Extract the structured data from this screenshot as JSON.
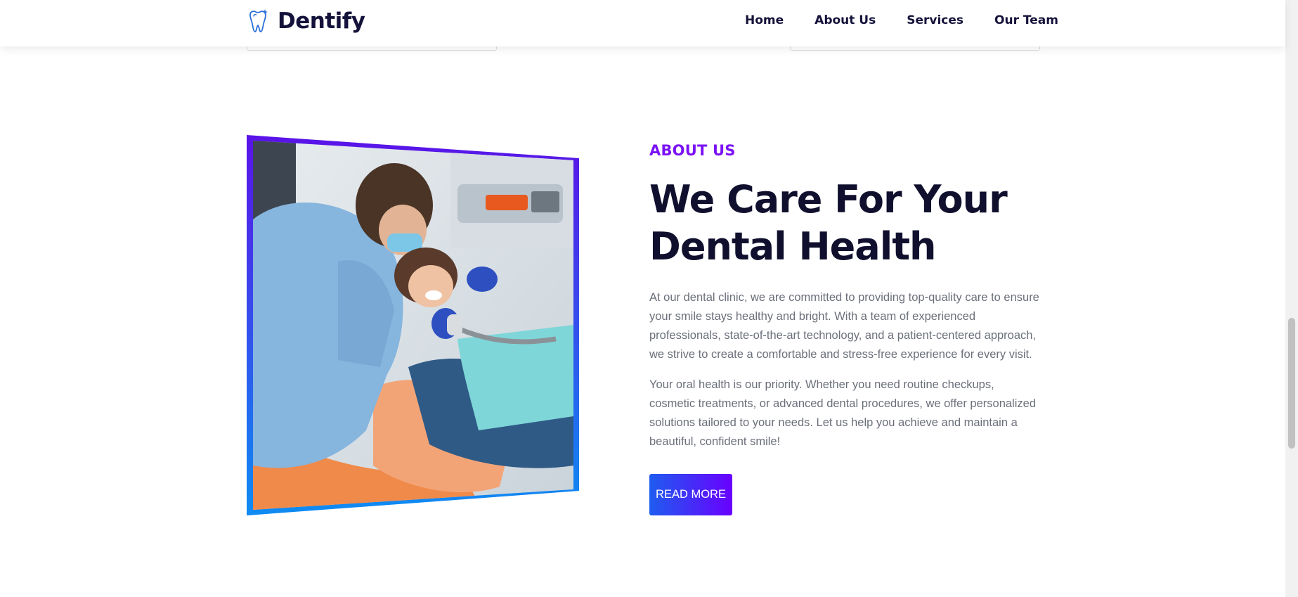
{
  "brand": {
    "name": "Dentify"
  },
  "nav": {
    "items": [
      "Home",
      "About Us",
      "Services",
      "Our Team"
    ]
  },
  "about": {
    "eyebrow": "ABOUT US",
    "heading_line1": "We Care For Your",
    "heading_line2": "Dental Health",
    "paragraph1": "At our dental clinic, we are committed to providing top-quality care to ensure your smile stays healthy and bright. With a team of experienced professionals, state-of-the-art technology, and a patient-centered approach, we strive to create a comfortable and stress-free experience for every visit.",
    "paragraph2": "Your oral health is our priority. Whether you need routine checkups, cosmetic treatments, or advanced dental procedures, we offer personalized solutions tailored to your needs. Let us help you achieve and maintain a beautiful, confident smile!",
    "button_label": "READ MORE"
  },
  "colors": {
    "accent_purple": "#7a12f5",
    "accent_blue": "#1e5cf0",
    "heading_dark": "#10102e",
    "body_text": "#6b6f7a"
  },
  "icons": {
    "logo": "tooth-sparkle-icon"
  }
}
